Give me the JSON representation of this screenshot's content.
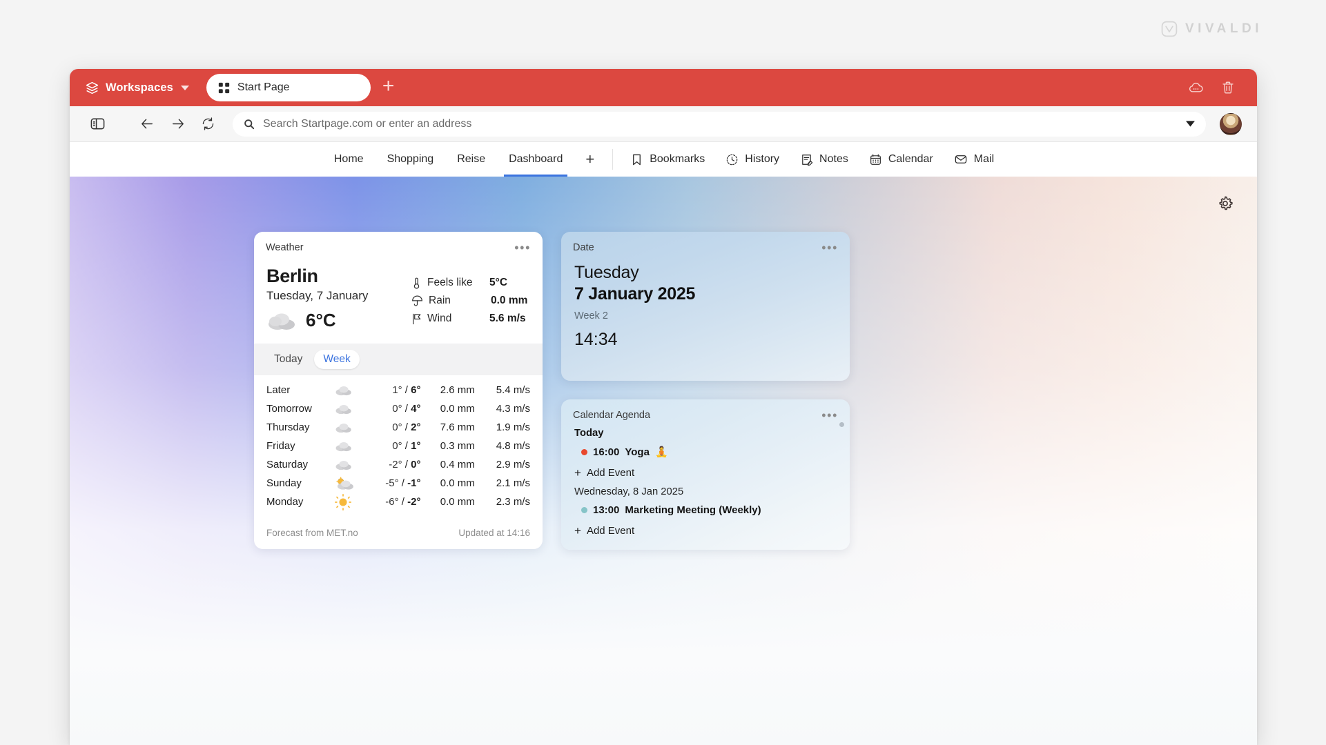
{
  "brand": {
    "name": "VIVALDI",
    "logo_icon": "vivaldi-logo-icon"
  },
  "tabbar": {
    "workspaces_label": "Workspaces",
    "workspaces_icon": "layers-icon",
    "workspaces_caret_icon": "chevron-down-icon",
    "tab_title": "Start Page",
    "tab_icon": "grid-icon",
    "new_tab_label": "+",
    "sync_icon": "cloud-sync-icon",
    "trash_icon": "trash-icon",
    "accent_color": "#dc4840"
  },
  "addressbar": {
    "panel_icon": "sidebar-panel-icon",
    "back_icon": "arrow-left-icon",
    "forward_icon": "arrow-right-icon",
    "reload_icon": "reload-icon",
    "search_icon": "search-icon",
    "placeholder": "Search Startpage.com or enter an address",
    "value": "",
    "dropdown_icon": "chevron-down-icon",
    "avatar_icon": "avatar"
  },
  "navstrip": {
    "tabs": [
      {
        "label": "Home",
        "active": false
      },
      {
        "label": "Shopping",
        "active": false
      },
      {
        "label": "Reise",
        "active": false
      },
      {
        "label": "Dashboard",
        "active": true
      }
    ],
    "add_label": "+",
    "tools": [
      {
        "label": "Bookmarks",
        "icon": "bookmark-icon"
      },
      {
        "label": "History",
        "icon": "history-icon"
      },
      {
        "label": "Notes",
        "icon": "notes-icon"
      },
      {
        "label": "Calendar",
        "icon": "calendar-icon"
      },
      {
        "label": "Mail",
        "icon": "mail-icon"
      }
    ],
    "active_indicator_color": "#3b73df"
  },
  "startpage": {
    "settings_icon": "gear-icon"
  },
  "weather": {
    "title": "Weather",
    "menu_icon": "more-options-icon",
    "city": "Berlin",
    "date": "Tuesday, 7 January",
    "current_icon": "cloud-icon",
    "current_temp": "6°C",
    "stats": [
      {
        "icon": "thermometer-icon",
        "label": "Feels like",
        "value": "5°C"
      },
      {
        "icon": "umbrella-icon",
        "label": "Rain",
        "value": "0.0 mm"
      },
      {
        "icon": "wind-flag-icon",
        "label": "Wind",
        "value": "5.6 m/s"
      }
    ],
    "tabs": [
      {
        "label": "Today",
        "active": false
      },
      {
        "label": "Week",
        "active": true
      }
    ],
    "forecast": [
      {
        "day": "Later",
        "icon": "cloud",
        "low": "1°",
        "high": "6°",
        "rain": "2.6 mm",
        "wind": "5.4 m/s"
      },
      {
        "day": "Tomorrow",
        "icon": "cloud",
        "low": "0°",
        "high": "4°",
        "rain": "0.0 mm",
        "wind": "4.3 m/s"
      },
      {
        "day": "Thursday",
        "icon": "cloud",
        "low": "0°",
        "high": "2°",
        "rain": "7.6 mm",
        "wind": "1.9 m/s"
      },
      {
        "day": "Friday",
        "icon": "cloud",
        "low": "0°",
        "high": "1°",
        "rain": "0.3 mm",
        "wind": "4.8 m/s"
      },
      {
        "day": "Saturday",
        "icon": "cloud",
        "low": "-2°",
        "high": "0°",
        "rain": "0.4 mm",
        "wind": "2.9 m/s"
      },
      {
        "day": "Sunday",
        "icon": "partly-cloudy",
        "low": "-5°",
        "high": "-1°",
        "rain": "0.0 mm",
        "wind": "2.1 m/s"
      },
      {
        "day": "Monday",
        "icon": "sun",
        "low": "-6°",
        "high": "-2°",
        "rain": "0.0 mm",
        "wind": "2.3 m/s"
      }
    ],
    "source": "Forecast from MET.no",
    "updated": "Updated at 14:16"
  },
  "date_widget": {
    "title": "Date",
    "menu_icon": "more-options-icon",
    "weekday": "Tuesday",
    "full_date": "7 January 2025",
    "week": "Week 2",
    "time": "14:34"
  },
  "agenda": {
    "title": "Calendar Agenda",
    "menu_icon": "more-options-icon",
    "groups": [
      {
        "label": "Today",
        "bold": true,
        "events": [
          {
            "time": "16:00",
            "name": "Yoga",
            "emoji": "🧘",
            "dot_color": "#e8482e"
          }
        ],
        "add_label": "Add Event"
      },
      {
        "label": "Wednesday,  8 Jan 2025",
        "bold": false,
        "events": [
          {
            "time": "13:00",
            "name": "Marketing Meeting (Weekly)",
            "emoji": "",
            "dot_color": "#86c4c8"
          }
        ],
        "add_label": "Add Event"
      }
    ]
  }
}
